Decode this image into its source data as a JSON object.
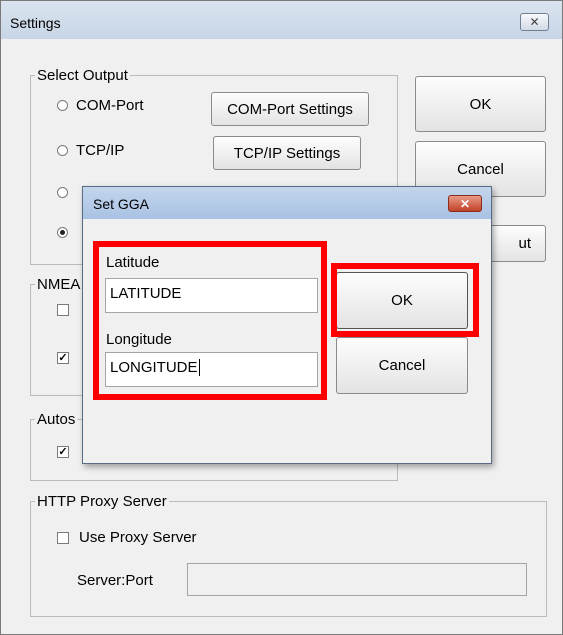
{
  "window": {
    "title": "Settings",
    "close_glyph": "✕"
  },
  "select_output": {
    "legend": "Select Output",
    "options": [
      {
        "label": "COM-Port",
        "checked": false
      },
      {
        "label": "TCP/IP",
        "checked": false
      },
      {
        "label": "",
        "checked": false
      },
      {
        "label": "",
        "checked": true
      }
    ],
    "com_settings_label": "COM-Port Settings",
    "tcp_settings_label": "TCP/IP Settings"
  },
  "main_buttons": {
    "ok_label": "OK",
    "cancel_label": "Cancel",
    "partial_label": "ut"
  },
  "nmea": {
    "legend": "NMEA",
    "check1_checked": false,
    "check2_checked": true
  },
  "autos": {
    "legend": "Autos",
    "check_checked": true
  },
  "proxy": {
    "legend": "HTTP Proxy Server",
    "use_proxy_label": "Use Proxy Server",
    "use_proxy_checked": false,
    "server_port_label": "Server:Port",
    "server_port_value": ""
  },
  "gga_dialog": {
    "title": "Set GGA",
    "close_glyph": "✕",
    "latitude_label": "Latitude",
    "latitude_value": "LATITUDE",
    "longitude_label": "Longitude",
    "longitude_value": "LONGITUDE",
    "ok_label": "OK",
    "cancel_label": "Cancel"
  },
  "colors": {
    "highlight": "#ff0000",
    "window_bg": "#f0f0f0"
  }
}
